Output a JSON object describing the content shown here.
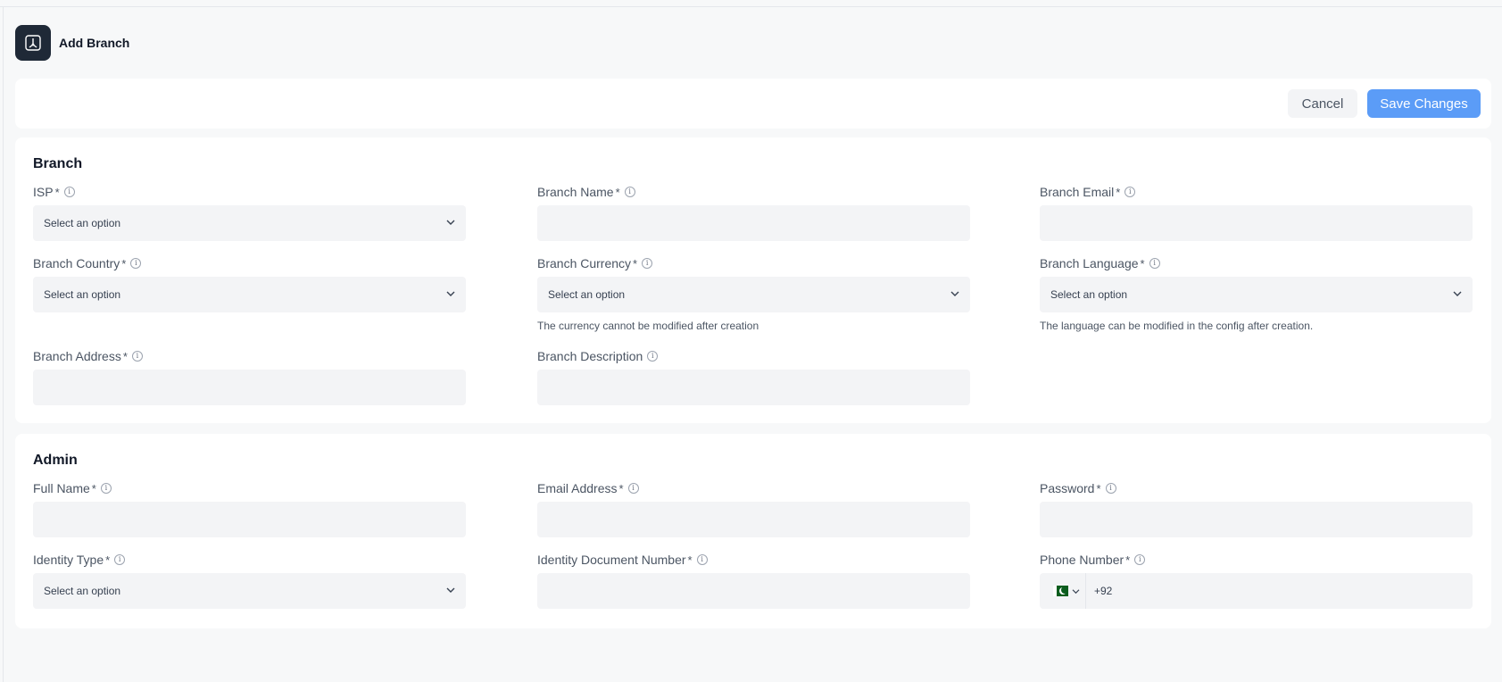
{
  "header": {
    "title": "Add Branch",
    "icon": "branch-icon"
  },
  "actions": {
    "cancel_label": "Cancel",
    "save_label": "Save Changes",
    "save_color": "#5b9cf7"
  },
  "branch_section": {
    "title": "Branch",
    "fields": {
      "isp": {
        "label": "ISP",
        "required": "*",
        "value": "Select an option"
      },
      "branch_name": {
        "label": "Branch Name",
        "required": "*",
        "value": ""
      },
      "branch_email": {
        "label": "Branch Email",
        "required": "*",
        "value": ""
      },
      "branch_country": {
        "label": "Branch Country",
        "required": "*",
        "value": "Select an option"
      },
      "branch_currency": {
        "label": "Branch Currency",
        "required": "*",
        "value": "Select an option",
        "helper": "The currency cannot be modified after creation"
      },
      "branch_language": {
        "label": "Branch Language",
        "required": "*",
        "value": "Select an option",
        "helper": "The language can be modified in the config after creation."
      },
      "branch_address": {
        "label": "Branch Address",
        "required": "*",
        "value": ""
      },
      "branch_description": {
        "label": "Branch Description",
        "value": ""
      }
    }
  },
  "admin_section": {
    "title": "Admin",
    "fields": {
      "full_name": {
        "label": "Full Name",
        "required": "*",
        "value": ""
      },
      "email_address": {
        "label": "Email Address",
        "required": "*",
        "value": ""
      },
      "password": {
        "label": "Password",
        "required": "*",
        "value": ""
      },
      "identity_type": {
        "label": "Identity Type",
        "required": "*",
        "value": "Select an option"
      },
      "identity_document_number": {
        "label": "Identity Document Number",
        "required": "*",
        "value": ""
      },
      "phone_number": {
        "label": "Phone Number",
        "required": "*",
        "country_flag": "pakistan-flag-icon",
        "dial_code": "+92"
      }
    }
  }
}
